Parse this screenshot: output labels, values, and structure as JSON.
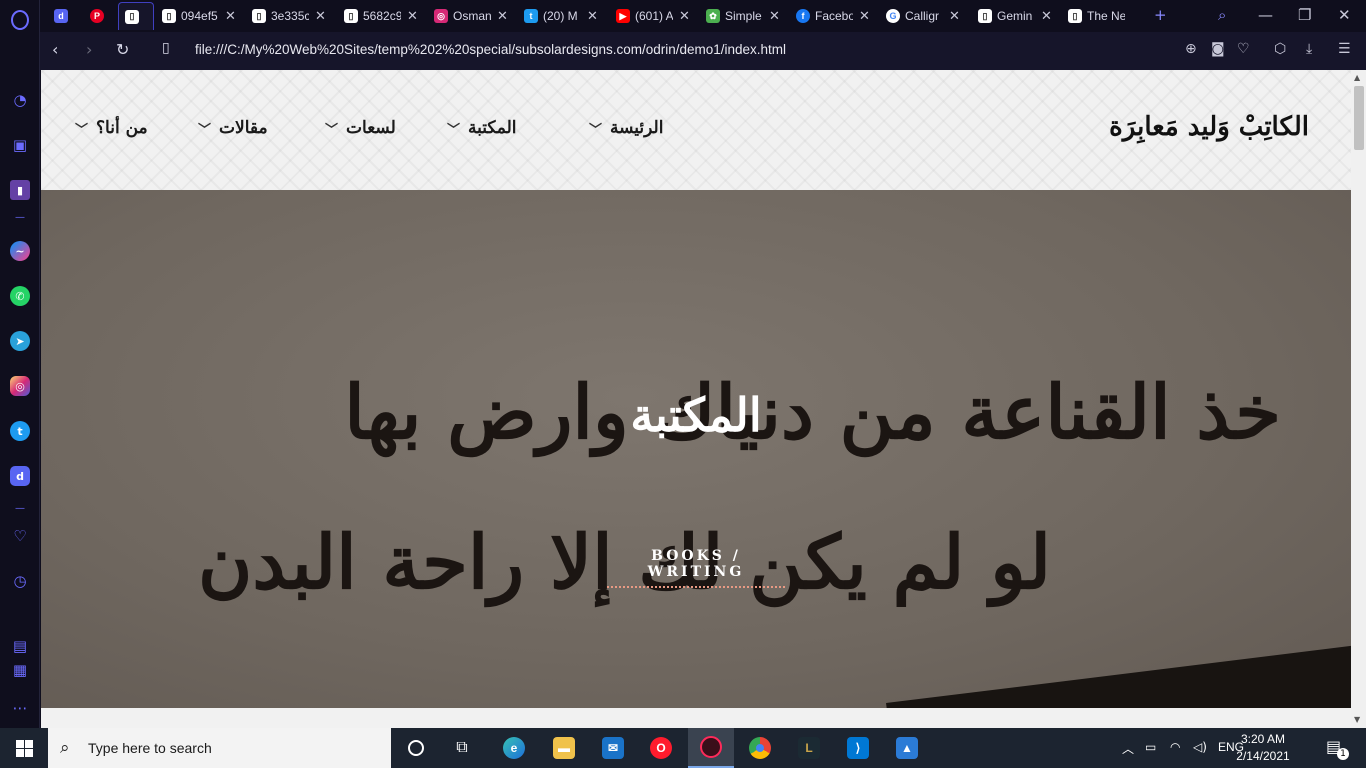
{
  "browser": {
    "tabs": [
      {
        "title": "",
        "icon": "discord-tab-icon",
        "color": "#5865f2"
      },
      {
        "title": "",
        "icon": "pinterest-tab-icon",
        "color": "#e60023"
      },
      {
        "title": "",
        "icon": "document-tab-icon",
        "color": "#ffffff"
      },
      {
        "title": "094ef5",
        "icon": "document-tab-icon",
        "color": "#ffffff"
      },
      {
        "title": "3e335c",
        "icon": "document-tab-icon",
        "color": "#ffffff"
      },
      {
        "title": "5682c9",
        "icon": "document-tab-icon",
        "color": "#ffffff"
      },
      {
        "title": "Osman",
        "icon": "instagram-tab-icon",
        "color": "#d62976"
      },
      {
        "title": "(20) M",
        "icon": "twitter-tab-icon",
        "color": "#1d9bf0"
      },
      {
        "title": "(601) A",
        "icon": "youtube-tab-icon",
        "color": "#ff0000"
      },
      {
        "title": "Simple",
        "icon": "simple-tab-icon",
        "color": "#4caf50"
      },
      {
        "title": "Facebo",
        "icon": "facebook-tab-icon",
        "color": "#1877f2"
      },
      {
        "title": "Calligr",
        "icon": "google-tab-icon",
        "color": "#ffffff"
      },
      {
        "title": "Gemin",
        "icon": "document-tab-icon",
        "color": "#ffffff"
      },
      {
        "title": "The Ne",
        "icon": "document-tab-icon",
        "color": "#ffffff"
      }
    ],
    "url": "file:///C:/My%20Web%20Sites/temp%202%20special/subsolardesigns.com/odrin/demo1/index.html"
  },
  "site": {
    "logo": "الكاتِبْ وَليد مَعابِرَة",
    "nav": [
      {
        "label": "الرئيسة"
      },
      {
        "label": "المكتبة"
      },
      {
        "label": "لسعات"
      },
      {
        "label": "مقالات"
      },
      {
        "label": "من أنا؟"
      }
    ],
    "hero": {
      "title": "المكتبة",
      "subtitle": "BOOKS / WRITING",
      "calligraphy_lines": [
        "خذ القناعة من دنياك وارض بها",
        "لو لم يكن لك إلا راحة البدن"
      ]
    }
  },
  "taskbar": {
    "search_placeholder": "Type here to search",
    "language": "ENG",
    "time": "3:20 AM",
    "date": "2/14/2021",
    "notifications": "1"
  }
}
